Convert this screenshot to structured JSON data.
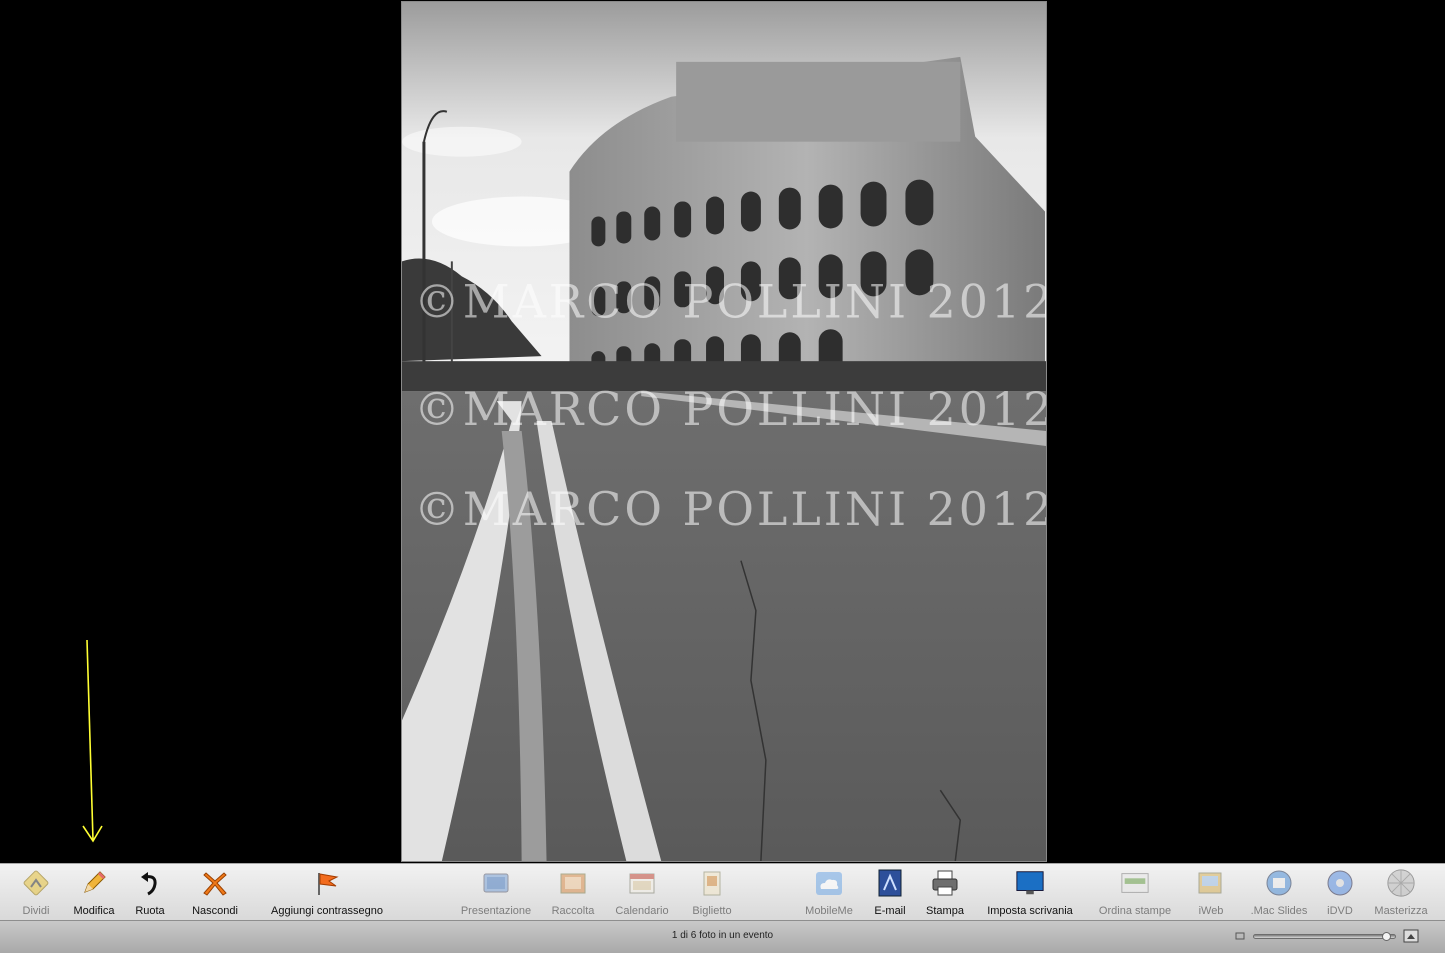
{
  "photo": {
    "subject": "Colosseo",
    "watermark_lines": [
      "©MARCO POLLINI 2012",
      "©MARCO POLLINI 2012",
      "©MARCO POLLINI 2012"
    ]
  },
  "toolbar": {
    "left": [
      {
        "id": "dividi",
        "label": "Dividi",
        "icon": "split-event-icon",
        "enabled": false
      },
      {
        "id": "modifica",
        "label": "Modifica",
        "icon": "pencil-icon",
        "enabled": true
      },
      {
        "id": "ruota",
        "label": "Ruota",
        "icon": "rotate-icon",
        "enabled": true
      },
      {
        "id": "nascondi",
        "label": "Nascondi",
        "icon": "hide-x-icon",
        "enabled": true
      },
      {
        "id": "contrassegno",
        "label": "Aggiungi contrassegno",
        "icon": "flag-icon",
        "enabled": true
      }
    ],
    "middle": [
      {
        "id": "presentazione",
        "label": "Presentazione",
        "icon": "slideshow-icon",
        "enabled": false
      },
      {
        "id": "raccolta",
        "label": "Raccolta",
        "icon": "book-icon",
        "enabled": false
      },
      {
        "id": "calendario",
        "label": "Calendario",
        "icon": "calendar-icon",
        "enabled": false
      },
      {
        "id": "biglietto",
        "label": "Biglietto",
        "icon": "card-icon",
        "enabled": false
      }
    ],
    "right": [
      {
        "id": "mobileme",
        "label": "MobileMe",
        "icon": "cloud-icon",
        "enabled": false
      },
      {
        "id": "email",
        "label": "E-mail",
        "icon": "email-icon",
        "enabled": true
      },
      {
        "id": "stampa",
        "label": "Stampa",
        "icon": "printer-icon",
        "enabled": true
      },
      {
        "id": "scrivania",
        "label": "Imposta scrivania",
        "icon": "desktop-icon",
        "enabled": true
      },
      {
        "id": "ordina",
        "label": "Ordina stampe",
        "icon": "order-prints-icon",
        "enabled": false
      },
      {
        "id": "iweb",
        "label": "iWeb",
        "icon": "iweb-icon",
        "enabled": false
      },
      {
        "id": "macslides",
        "label": ".Mac Slides",
        "icon": "mac-slides-icon",
        "enabled": false
      },
      {
        "id": "idvd",
        "label": "iDVD",
        "icon": "dvd-icon",
        "enabled": false
      },
      {
        "id": "masterizza",
        "label": "Masterizza",
        "icon": "burn-disc-icon",
        "enabled": false
      }
    ]
  },
  "status": {
    "text": "1 di 6 foto in un evento",
    "zoom_fraction": 0.97
  },
  "colors": {
    "annotation_arrow": "#ffff33",
    "toolbar_bg": "#e6e6e6",
    "background": "#000000"
  }
}
